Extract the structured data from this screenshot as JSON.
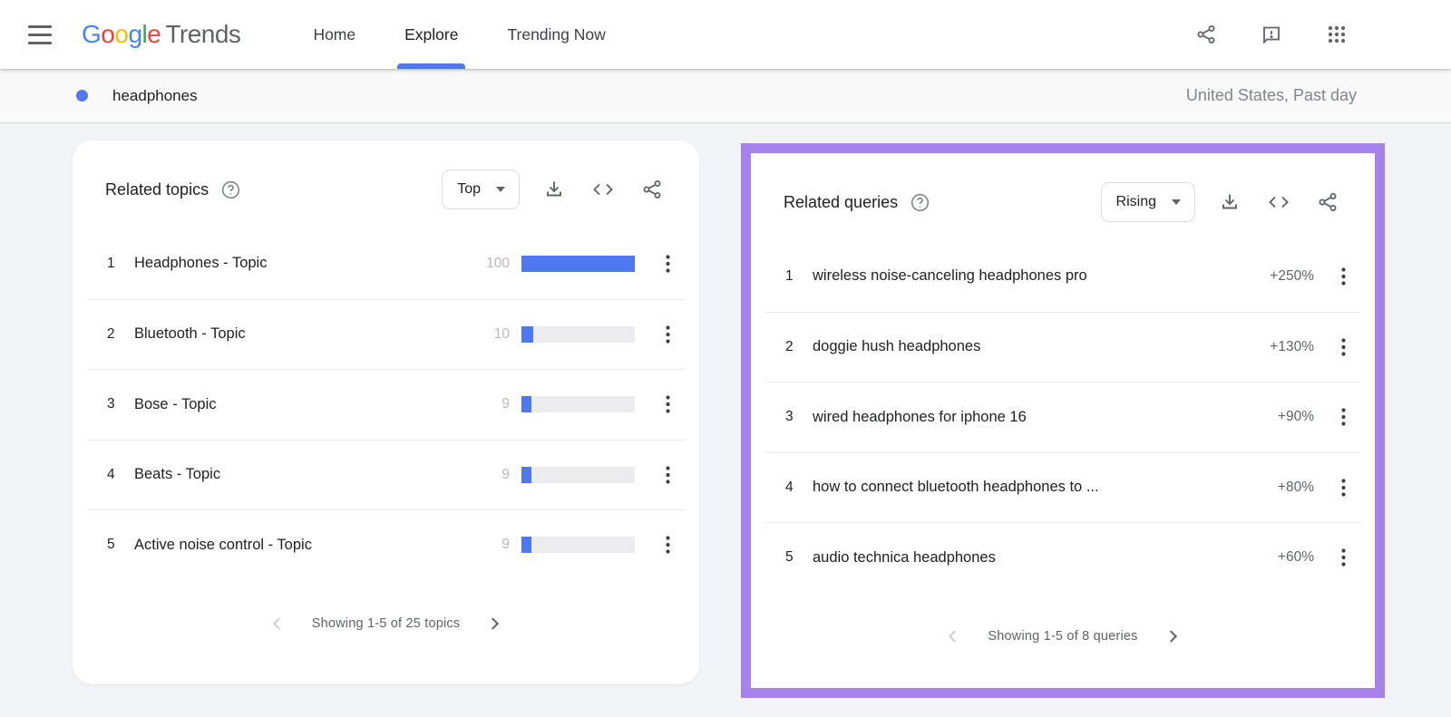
{
  "topbar": {
    "logo": {
      "letters": [
        "G",
        "o",
        "o",
        "g",
        "l",
        "e"
      ],
      "suffix": "Trends"
    },
    "nav": [
      {
        "label": "Home",
        "active": false
      },
      {
        "label": "Explore",
        "active": true
      },
      {
        "label": "Trending Now",
        "active": false
      }
    ],
    "icons": [
      "share-icon",
      "feedback-icon",
      "apps-grid-icon"
    ]
  },
  "term_bar": {
    "term": "headphones",
    "scope": "United States, Past day"
  },
  "cards": {
    "related_topics": {
      "title": "Related topics",
      "sort_selected": "Top",
      "toolbar_icons": [
        "download-icon",
        "embed-icon",
        "share-icon"
      ],
      "rows": [
        {
          "rank": "1",
          "label": "Headphones - Topic",
          "value": "100",
          "bar_pct": 100
        },
        {
          "rank": "2",
          "label": "Bluetooth - Topic",
          "value": "10",
          "bar_pct": 10
        },
        {
          "rank": "3",
          "label": "Bose - Topic",
          "value": "9",
          "bar_pct": 9
        },
        {
          "rank": "4",
          "label": "Beats - Topic",
          "value": "9",
          "bar_pct": 9
        },
        {
          "rank": "5",
          "label": "Active noise control - Topic",
          "value": "9",
          "bar_pct": 9
        }
      ],
      "pager": "Showing 1-5 of 25 topics"
    },
    "related_queries": {
      "title": "Related queries",
      "sort_selected": "Rising",
      "toolbar_icons": [
        "download-icon",
        "embed-icon",
        "share-icon"
      ],
      "rows": [
        {
          "rank": "1",
          "label": "wireless noise-canceling headphones pro",
          "value": "+250%"
        },
        {
          "rank": "2",
          "label": "doggie hush headphones",
          "value": "+130%"
        },
        {
          "rank": "3",
          "label": "wired headphones for iphone 16",
          "value": "+90%"
        },
        {
          "rank": "4",
          "label": "how to connect bluetooth headphones to ...",
          "value": "+80%"
        },
        {
          "rank": "5",
          "label": "audio technica headphones",
          "value": "+60%"
        }
      ],
      "pager": "Showing 1-5 of 8 queries"
    }
  },
  "colors": {
    "accent_blue": "#4e79ee",
    "highlight_purple": "#a782ec",
    "term_dot_blue": "#5279ef",
    "bar_track_gray": "#ececee",
    "logo_blue": "#4285F4",
    "logo_red": "#EA4335",
    "logo_yellow": "#FBBC05",
    "logo_green": "#34A853"
  }
}
